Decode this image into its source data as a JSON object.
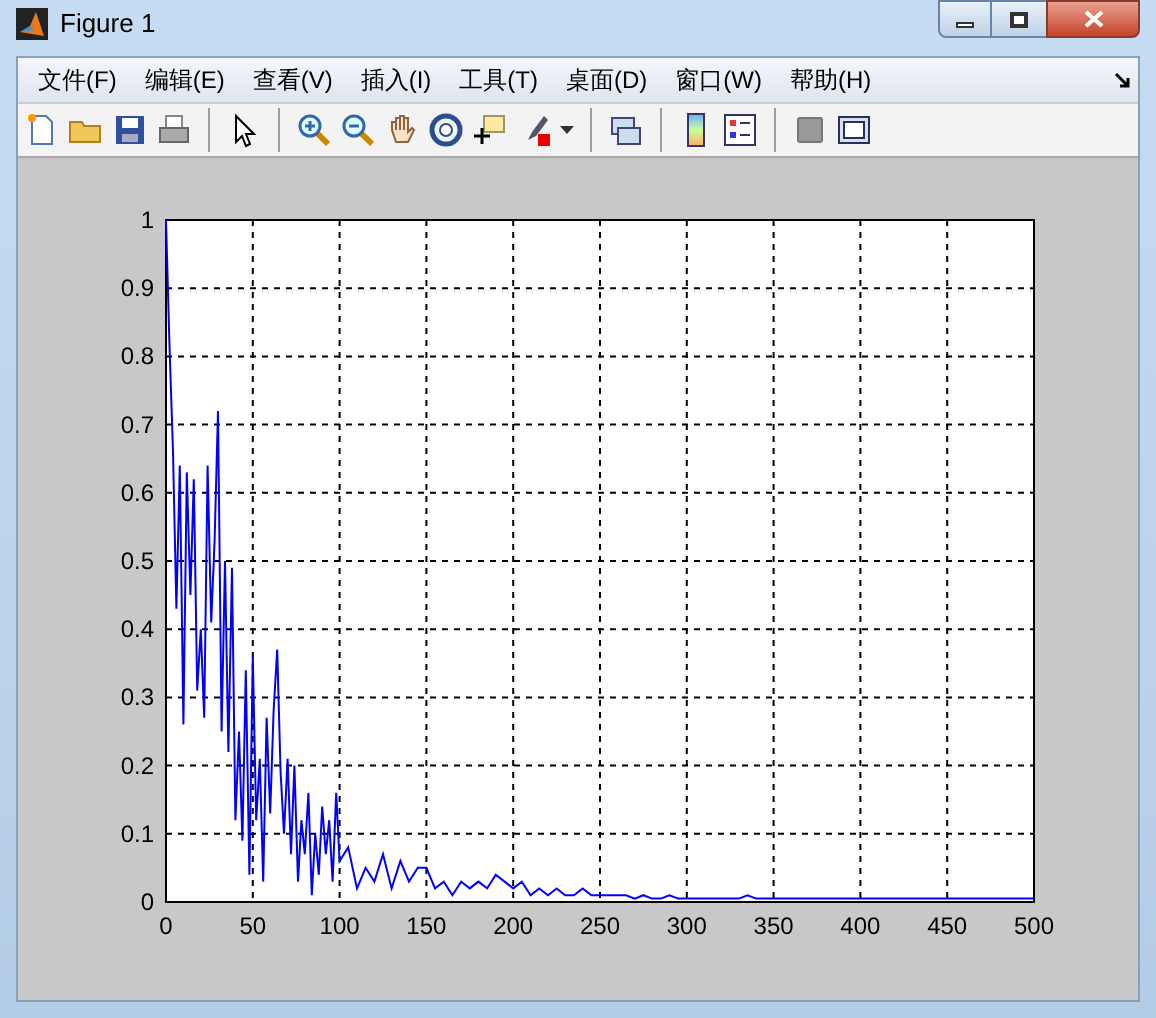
{
  "window": {
    "title": "Figure 1"
  },
  "menu": [
    {
      "label": "文件(F)"
    },
    {
      "label": "编辑(E)"
    },
    {
      "label": "查看(V)"
    },
    {
      "label": "插入(I)"
    },
    {
      "label": "工具(T)"
    },
    {
      "label": "桌面(D)"
    },
    {
      "label": "窗口(W)"
    },
    {
      "label": "帮助(H)"
    }
  ],
  "toolbar": [
    {
      "kind": "new"
    },
    {
      "kind": "open"
    },
    {
      "kind": "save"
    },
    {
      "kind": "print"
    },
    {
      "kind": "separator"
    },
    {
      "kind": "pointer"
    },
    {
      "kind": "separator"
    },
    {
      "kind": "zoom-in"
    },
    {
      "kind": "zoom-out"
    },
    {
      "kind": "pan"
    },
    {
      "kind": "rotate"
    },
    {
      "kind": "data-cursor"
    },
    {
      "kind": "brush"
    },
    {
      "kind": "dropdown"
    },
    {
      "kind": "separator"
    },
    {
      "kind": "link"
    },
    {
      "kind": "separator"
    },
    {
      "kind": "colorbar"
    },
    {
      "kind": "legend"
    },
    {
      "kind": "separator"
    },
    {
      "kind": "hide-tools"
    },
    {
      "kind": "show-tools"
    }
  ],
  "plot": {
    "chart_data": {
      "type": "line",
      "grid": true,
      "xlim": [
        0,
        500
      ],
      "ylim": [
        0,
        1
      ],
      "xticks": [
        0,
        50,
        100,
        150,
        200,
        250,
        300,
        350,
        400,
        450,
        500
      ],
      "yticks": [
        1,
        0.9,
        0.8,
        0.7,
        0.6,
        0.5,
        0.4,
        0.3,
        0.2,
        0.1,
        0
      ],
      "x": [
        0,
        2,
        4,
        6,
        8,
        10,
        12,
        14,
        16,
        18,
        20,
        22,
        24,
        26,
        28,
        30,
        32,
        34,
        36,
        38,
        40,
        42,
        44,
        46,
        48,
        50,
        52,
        54,
        56,
        58,
        60,
        62,
        64,
        66,
        68,
        70,
        72,
        74,
        76,
        78,
        80,
        82,
        84,
        86,
        88,
        90,
        92,
        94,
        96,
        98,
        100,
        105,
        110,
        115,
        120,
        125,
        130,
        135,
        140,
        145,
        150,
        155,
        160,
        165,
        170,
        175,
        180,
        185,
        190,
        195,
        200,
        205,
        210,
        215,
        220,
        225,
        230,
        235,
        240,
        245,
        250,
        255,
        260,
        265,
        270,
        275,
        280,
        285,
        290,
        295,
        300,
        305,
        310,
        315,
        320,
        325,
        330,
        335,
        340,
        345,
        350,
        355,
        360,
        365,
        370,
        375,
        380,
        385,
        390,
        395,
        400,
        405,
        410,
        415,
        420,
        425,
        430,
        435,
        440,
        445,
        450,
        455,
        460,
        465,
        470,
        475,
        480,
        485,
        490,
        495,
        500
      ],
      "series": [
        {
          "color": "#0000ff",
          "values": [
            1.0,
            0.82,
            0.66,
            0.43,
            0.64,
            0.26,
            0.63,
            0.45,
            0.62,
            0.31,
            0.4,
            0.27,
            0.64,
            0.41,
            0.53,
            0.72,
            0.25,
            0.5,
            0.22,
            0.49,
            0.12,
            0.25,
            0.09,
            0.34,
            0.04,
            0.36,
            0.12,
            0.21,
            0.03,
            0.27,
            0.13,
            0.28,
            0.37,
            0.19,
            0.1,
            0.21,
            0.07,
            0.2,
            0.03,
            0.12,
            0.07,
            0.16,
            0.01,
            0.1,
            0.04,
            0.14,
            0.07,
            0.12,
            0.03,
            0.16,
            0.06,
            0.08,
            0.02,
            0.05,
            0.03,
            0.07,
            0.02,
            0.06,
            0.03,
            0.05,
            0.05,
            0.02,
            0.03,
            0.01,
            0.03,
            0.02,
            0.03,
            0.02,
            0.04,
            0.03,
            0.02,
            0.03,
            0.01,
            0.02,
            0.01,
            0.02,
            0.01,
            0.01,
            0.02,
            0.01,
            0.01,
            0.01,
            0.01,
            0.01,
            0.005,
            0.01,
            0.005,
            0.005,
            0.01,
            0.005,
            0.005,
            0.005,
            0.005,
            0.005,
            0.005,
            0.005,
            0.005,
            0.01,
            0.005,
            0.005,
            0.005,
            0.005,
            0.005,
            0.005,
            0.005,
            0.005,
            0.005,
            0.005,
            0.005,
            0.005,
            0.005,
            0.005,
            0.005,
            0.005,
            0.005,
            0.005,
            0.005,
            0.005,
            0.005,
            0.005,
            0.005,
            0.005,
            0.005,
            0.005,
            0.005,
            0.005,
            0.005,
            0.005,
            0.005,
            0.005,
            0.005
          ]
        }
      ]
    }
  }
}
